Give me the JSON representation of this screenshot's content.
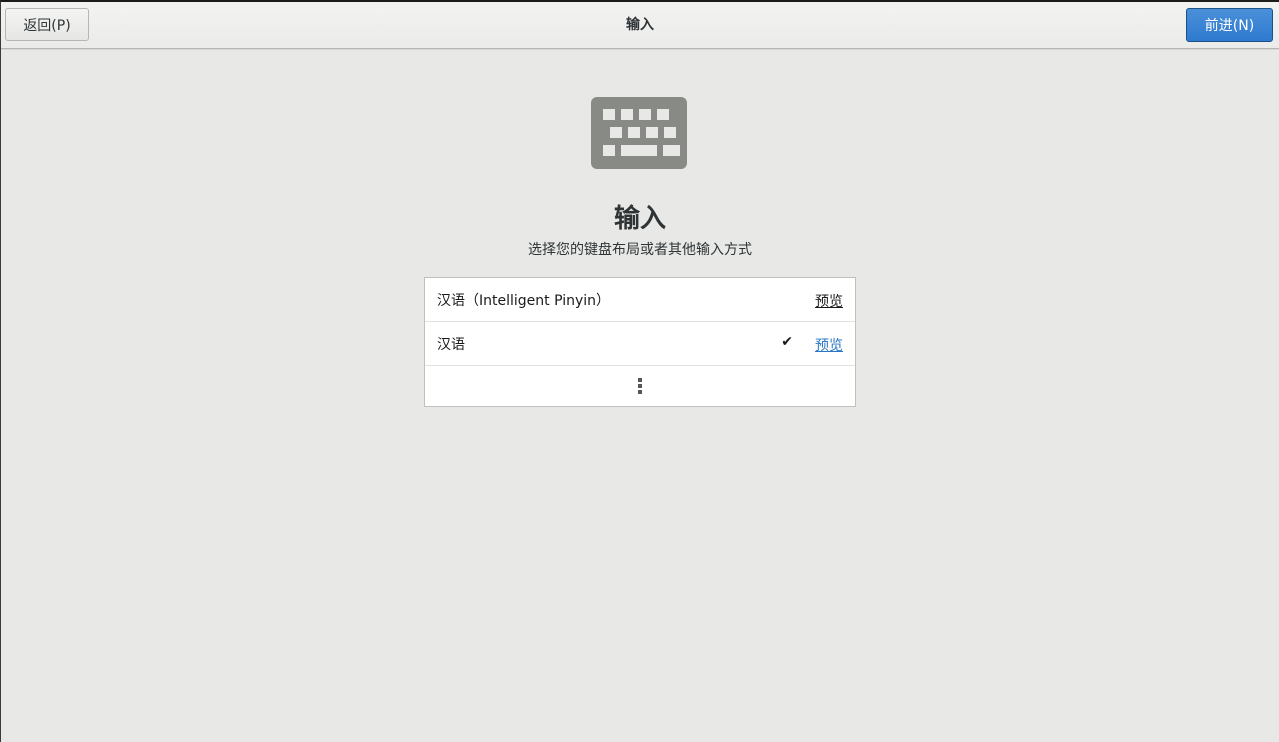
{
  "header": {
    "back_label": "返回(P)",
    "title": "输入",
    "next_label": "前进(N)"
  },
  "main": {
    "icon": "keyboard-icon",
    "heading": "输入",
    "subheading": "选择您的键盘布局或者其他输入方式",
    "input_sources": [
      {
        "label": "汉语（Intelligent Pinyin）",
        "preview_label": "预览",
        "selected": false
      },
      {
        "label": "汉语",
        "preview_label": "预览",
        "selected": true
      }
    ],
    "more_icon": "vertical-ellipsis-icon"
  },
  "colors": {
    "accent": "#2f7ad0",
    "background": "#e8e8e7",
    "icon_gray": "#888a85"
  }
}
